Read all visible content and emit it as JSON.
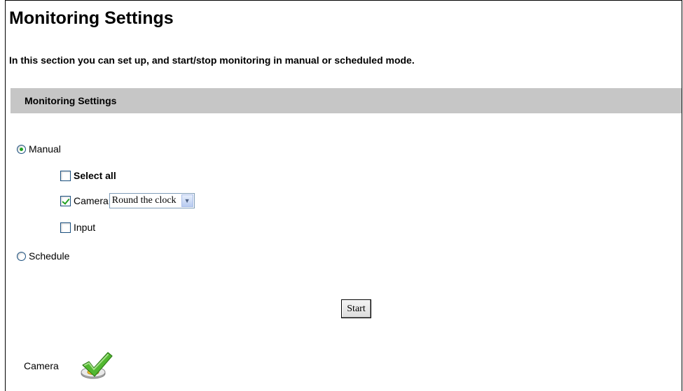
{
  "header": {
    "title": "Monitoring Settings",
    "description": "In this section you can set up, and start/stop monitoring in manual or scheduled mode."
  },
  "section": {
    "title": "Monitoring Settings"
  },
  "mode": {
    "selected": "manual",
    "manual_label": "Manual",
    "schedule_label": "Schedule"
  },
  "options": {
    "select_all": {
      "label": "Select all",
      "checked": false
    },
    "camera": {
      "label": "Camera",
      "checked": true,
      "selected_value": "Round the clock"
    },
    "input": {
      "label": "Input",
      "checked": false
    }
  },
  "actions": {
    "start_label": "Start"
  },
  "status": {
    "label": "Camera",
    "icon": "camera-monitoring-check-icon"
  },
  "colors": {
    "section_bar": "#c6c6c6",
    "check": "#21a121"
  }
}
